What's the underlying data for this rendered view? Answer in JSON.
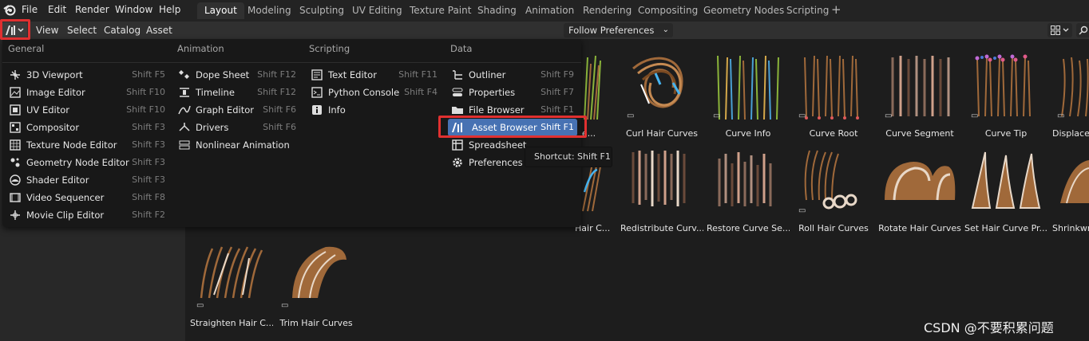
{
  "app_menu": [
    "File",
    "Edit",
    "Render",
    "Window",
    "Help"
  ],
  "workspaces": [
    "Layout",
    "Modeling",
    "Sculpting",
    "UV Editing",
    "Texture Paint",
    "Shading",
    "Animation",
    "Rendering",
    "Compositing",
    "Geometry Nodes",
    "Scripting"
  ],
  "active_workspace": "Layout",
  "add_workspace": "+",
  "header_menu": [
    "View",
    "Select",
    "Catalog",
    "Asset"
  ],
  "follow_prefs": "Follow Preferences",
  "editor_menu": {
    "columns": [
      {
        "title": "General",
        "items": [
          {
            "label": "3D Viewport",
            "shortcut": "Shift F5",
            "icon": "viewport-icon"
          },
          {
            "label": "Image Editor",
            "shortcut": "Shift F10",
            "icon": "image-icon"
          },
          {
            "label": "UV Editor",
            "shortcut": "Shift F10",
            "icon": "uv-icon"
          },
          {
            "label": "Compositor",
            "shortcut": "Shift F3",
            "icon": "compositor-icon"
          },
          {
            "label": "Texture Node Editor",
            "shortcut": "Shift F3",
            "icon": "texture-icon"
          },
          {
            "label": "Geometry Node Editor",
            "shortcut": "Shift F3",
            "icon": "geometry-nodes-icon"
          },
          {
            "label": "Shader Editor",
            "shortcut": "Shift F3",
            "icon": "shader-icon"
          },
          {
            "label": "Video Sequencer",
            "shortcut": "Shift F8",
            "icon": "sequencer-icon"
          },
          {
            "label": "Movie Clip Editor",
            "shortcut": "Shift F2",
            "icon": "clip-icon"
          }
        ]
      },
      {
        "title": "Animation",
        "items": [
          {
            "label": "Dope Sheet",
            "shortcut": "Shift F12",
            "icon": "dopesheet-icon"
          },
          {
            "label": "Timeline",
            "shortcut": "Shift F12",
            "icon": "timeline-icon"
          },
          {
            "label": "Graph Editor",
            "shortcut": "Shift F6",
            "icon": "graph-icon"
          },
          {
            "label": "Drivers",
            "shortcut": "Shift F6",
            "icon": "drivers-icon"
          },
          {
            "label": "Nonlinear Animation",
            "shortcut": "",
            "icon": "nla-icon"
          }
        ]
      },
      {
        "title": "Scripting",
        "items": [
          {
            "label": "Text Editor",
            "shortcut": "Shift F11",
            "icon": "text-icon"
          },
          {
            "label": "Python Console",
            "shortcut": "Shift F4",
            "icon": "console-icon"
          },
          {
            "label": "Info",
            "shortcut": "",
            "icon": "info-icon"
          }
        ]
      },
      {
        "title": "Data",
        "items": [
          {
            "label": "Outliner",
            "shortcut": "Shift F9",
            "icon": "outliner-icon"
          },
          {
            "label": "Properties",
            "shortcut": "Shift F7",
            "icon": "properties-icon"
          },
          {
            "label": "File Browser",
            "shortcut": "Shift F1",
            "icon": "folder-icon"
          },
          {
            "label": "Asset Browser",
            "shortcut": "Shift F1",
            "icon": "asset-browser-icon"
          },
          {
            "label": "Spreadsheet",
            "shortcut": "",
            "icon": "spreadsheet-icon"
          },
          {
            "label": "Preferences",
            "shortcut": "",
            "icon": "gear-icon"
          }
        ]
      }
    ],
    "selected": "Asset Browser"
  },
  "tooltip": "Shortcut: Shift F1",
  "assets_row1": [
    "k Inde...",
    "Curl Hair Curves",
    "Curve Info",
    "Curve Root",
    "Curve Segment",
    "Curve Tip",
    "Displace"
  ],
  "assets_row2": [
    "Hair C...",
    "Redistribute Curv...",
    "Restore Curve Se...",
    "Roll Hair Curves",
    "Rotate Hair Curves",
    "Set Hair Curve Pr...",
    "Shrinkwra"
  ],
  "assets_row3": [
    "Straighten Hair C...",
    "Trim Hair Curves"
  ],
  "watermark": "CSDN @不要积累问题",
  "colors": {
    "accent": "#4772b3",
    "highlight": "#e03030",
    "hair": "#a0693a"
  }
}
